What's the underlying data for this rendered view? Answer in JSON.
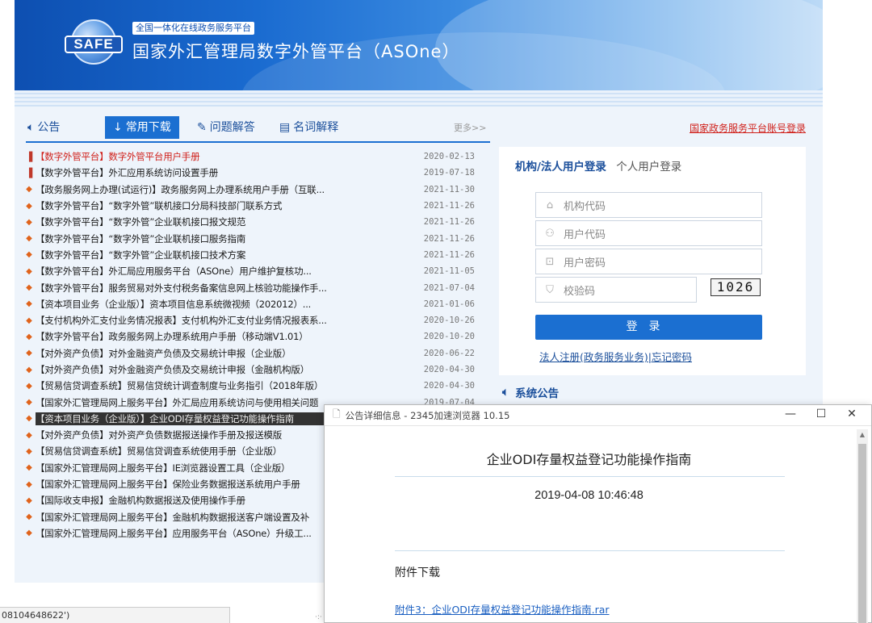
{
  "header": {
    "logo_text": "SAFE",
    "subtitle": "全国一体化在线政务服务平台",
    "title": "国家外汇管理局数字外管平台（ASOne）"
  },
  "tabs": {
    "announcement": "公告",
    "downloads": "常用下载",
    "faq": "问题解答",
    "glossary": "名词解释",
    "more": "更多>>",
    "gov_login": "国家政务服务平台账号登录"
  },
  "documents": [
    {
      "text": "【数字外管平台】数字外管平台用户手册",
      "date": "2020-02-13"
    },
    {
      "text": "【数字外管平台】外汇应用系统访问设置手册",
      "date": "2019-07-18"
    },
    {
      "text": "【政务服务网上办理(试运行)】政务服务网上办理系统用户手册（互联...",
      "date": "2021-11-30"
    },
    {
      "text": "【数字外管平台】“数字外管”联机接口分局科技部门联系方式",
      "date": "2021-11-26"
    },
    {
      "text": "【数字外管平台】“数字外管”企业联机接口报文规范",
      "date": "2021-11-26"
    },
    {
      "text": "【数字外管平台】“数字外管”企业联机接口服务指南",
      "date": "2021-11-26"
    },
    {
      "text": "【数字外管平台】“数字外管”企业联机接口技术方案",
      "date": "2021-11-26"
    },
    {
      "text": "【数字外管平台】外汇局应用服务平台（ASOne）用户维护复核功...",
      "date": "2021-11-05"
    },
    {
      "text": "【数字外管平台】服务贸易对外支付税务备案信息网上核验功能操作手...",
      "date": "2021-07-04"
    },
    {
      "text": "【资本项目业务（企业版）】资本项目信息系统微视频（202012）...",
      "date": "2021-01-06"
    },
    {
      "text": "【支付机构外汇支付业务情况报表】支付机构外汇支付业务情况报表系...",
      "date": "2020-10-26"
    },
    {
      "text": "【数字外管平台】政务服务网上办理系统用户手册（移动端V1.01）",
      "date": "2020-10-20"
    },
    {
      "text": "【对外资产负债】对外金融资产负债及交易统计申报（企业版）",
      "date": "2020-06-22"
    },
    {
      "text": "【对外资产负债】对外金融资产负债及交易统计申报（金融机构版）",
      "date": "2020-04-30"
    },
    {
      "text": "【贸易信贷调查系统】贸易信贷统计调查制度与业务指引（2018年版）",
      "date": "2020-04-30"
    },
    {
      "text": "【国家外汇管理局网上服务平台】外汇局应用系统访问与使用相关问题",
      "date": "2019-07-04"
    },
    {
      "text": "【资本项目业务（企业版）】企业ODI存量权益登记功能操作指南",
      "date": ""
    },
    {
      "text": "【对外资产负债】对外资产负债数据报送操作手册及报送模版",
      "date": ""
    },
    {
      "text": "【贸易信贷调查系统】贸易信贷调查系统使用手册（企业版）",
      "date": ""
    },
    {
      "text": "【国家外汇管理局网上服务平台】IE浏览器设置工具（企业版）",
      "date": ""
    },
    {
      "text": "【国家外汇管理局网上服务平台】保险业务数据报送系统用户手册",
      "date": ""
    },
    {
      "text": "【国际收支申报】金融机构数据报送及使用操作手册",
      "date": ""
    },
    {
      "text": "【国家外汇管理局网上服务平台】金融机构数据报送客户端设置及补",
      "date": ""
    },
    {
      "text": "【国家外汇管理局网上服务平台】应用服务平台（ASOne）升级工...",
      "date": ""
    }
  ],
  "login": {
    "tab_org": "机构/法人用户登录",
    "tab_personal": "个人用户登录",
    "org_code_placeholder": "机构代码",
    "user_code_placeholder": "用户代码",
    "password_placeholder": "用户密码",
    "captcha_placeholder": "校验码",
    "captcha_value": "1026",
    "login_button": "登录",
    "register_link": "法人注册(政务服务业务)",
    "forgot_link": "忘记密码"
  },
  "system_announcement": "系统公告",
  "status_bar_text": "08104648622')",
  "popup": {
    "window_title": "公告详细信息 - 2345加速浏览器 10.15",
    "heading": "企业ODI存量权益登记功能操作指南",
    "datetime": "2019-04-08 10:46:48",
    "attachment_label": "附件下载",
    "attachment_link": "附件3：企业ODI存量权益登记功能操作指南.rar"
  },
  "colors": {
    "brand_blue": "#1b6fd1",
    "link_blue": "#1b4f9b",
    "alert_red": "#d0211b"
  }
}
